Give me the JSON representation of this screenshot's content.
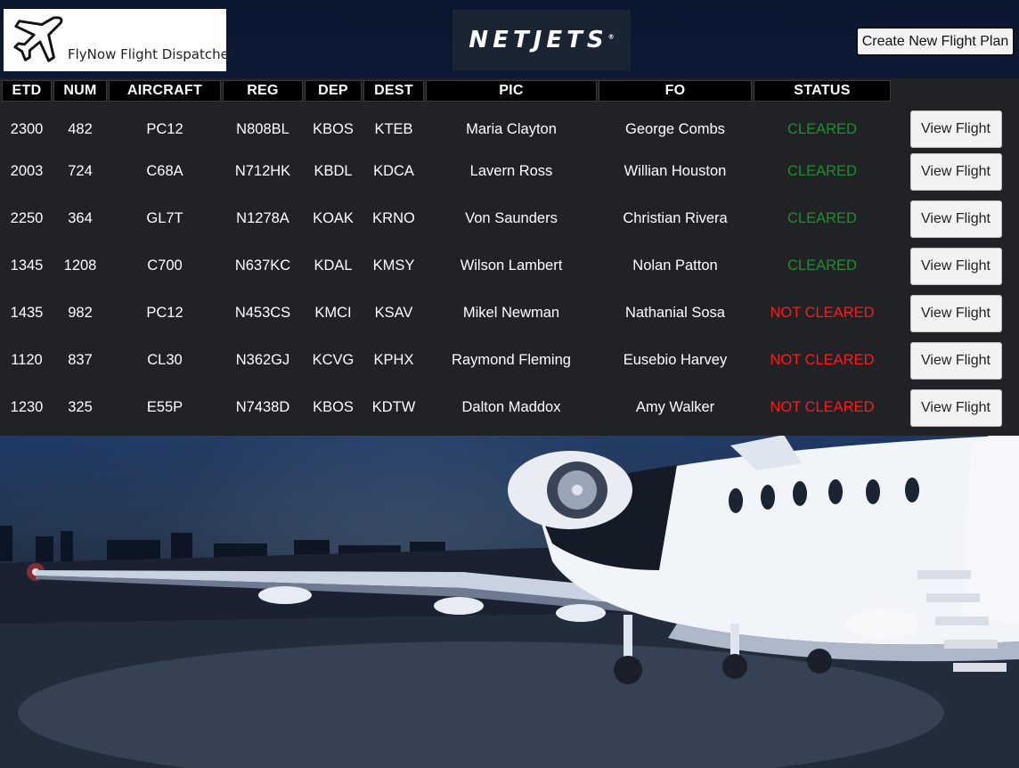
{
  "header": {
    "logo_text": "FlyNow Flight Dispatcher",
    "brand_name": "NETJETS",
    "brand_mark": "®",
    "create_button_label": "Create New Flight Plan"
  },
  "table": {
    "columns": [
      "ETD",
      "NUM",
      "AIRCRAFT",
      "REG",
      "DEP",
      "DEST",
      "PIC",
      "FO",
      "STATUS"
    ],
    "rows": [
      {
        "etd": "2300",
        "num": "482",
        "aircraft": "PC12",
        "reg": "N808BL",
        "dep": "KBOS",
        "dest": "KTEB",
        "pic": "Maria Clayton",
        "fo": "George Combs",
        "status": "CLEARED",
        "action": "View Flight"
      },
      {
        "etd": "2003",
        "num": "724",
        "aircraft": "C68A",
        "reg": "N712HK",
        "dep": "KBDL",
        "dest": "KDCA",
        "pic": "Lavern Ross",
        "fo": "Willian Houston",
        "status": "CLEARED",
        "action": "View Flight"
      },
      {
        "etd": "2250",
        "num": "364",
        "aircraft": "GL7T",
        "reg": "N1278A",
        "dep": "KOAK",
        "dest": "KRNO",
        "pic": "Von Saunders",
        "fo": "Christian Rivera",
        "status": "CLEARED",
        "action": "View Flight"
      },
      {
        "etd": "1345",
        "num": "1208",
        "aircraft": "C700",
        "reg": "N637KC",
        "dep": "KDAL",
        "dest": "KMSY",
        "pic": "Wilson Lambert",
        "fo": "Nolan Patton",
        "status": "CLEARED",
        "action": "View Flight"
      },
      {
        "etd": "1435",
        "num": "982",
        "aircraft": "PC12",
        "reg": "N453CS",
        "dep": "KMCI",
        "dest": "KSAV",
        "pic": "Mikel Newman",
        "fo": "Nathanial Sosa",
        "status": "NOT CLEARED",
        "action": "View Flight"
      },
      {
        "etd": "1120",
        "num": "837",
        "aircraft": "CL30",
        "reg": "N362GJ",
        "dep": "KCVG",
        "dest": "KPHX",
        "pic": "Raymond Fleming",
        "fo": "Eusebio Harvey",
        "status": "NOT CLEARED",
        "action": "View Flight"
      },
      {
        "etd": "1230",
        "num": "325",
        "aircraft": "E55P",
        "reg": "N7438D",
        "dep": "KBOS",
        "dest": "KDTW",
        "pic": "Dalton Maddox",
        "fo": "Amy Walker",
        "status": "NOT CLEARED",
        "action": "View Flight"
      }
    ]
  },
  "colors": {
    "cleared": "#1f8f2d",
    "not_cleared": "#ff1a1a",
    "table_bg": "#212226",
    "header_cell_bg": "#000000"
  },
  "icons": {
    "logo": "airplane-icon",
    "background": "business-jet-photo"
  }
}
